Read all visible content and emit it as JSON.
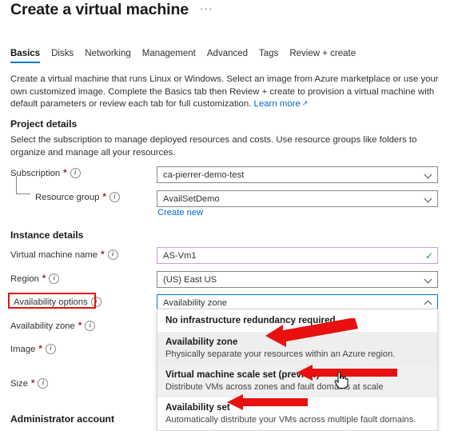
{
  "header": {
    "title": "Create a virtual machine",
    "more_menu": "···"
  },
  "tabs": [
    {
      "label": "Basics",
      "selected": true
    },
    {
      "label": "Disks",
      "selected": false
    },
    {
      "label": "Networking",
      "selected": false
    },
    {
      "label": "Management",
      "selected": false
    },
    {
      "label": "Advanced",
      "selected": false
    },
    {
      "label": "Tags",
      "selected": false
    },
    {
      "label": "Review + create",
      "selected": false
    }
  ],
  "intro": {
    "text": "Create a virtual machine that runs Linux or Windows. Select an image from Azure marketplace or use your own customized image. Complete the Basics tab then Review + create to provision a virtual machine with default parameters or review each tab for full customization. ",
    "link": "Learn more",
    "link_icon": "external-link-icon"
  },
  "project_details": {
    "heading": "Project details",
    "description": "Select the subscription to manage deployed resources and costs. Use resource groups like folders to organize and manage all your resources.",
    "subscription": {
      "label": "Subscription",
      "required": "*",
      "info": "i",
      "value": "ca-pierrer-demo-test"
    },
    "resource_group": {
      "label": "Resource group",
      "required": "*",
      "info": "i",
      "value": "AvailSetDemo",
      "create_new": "Create new"
    }
  },
  "instance_details": {
    "heading": "Instance details",
    "vm_name": {
      "label": "Virtual machine name",
      "required": "*",
      "info": "i",
      "value": "AS-Vm1",
      "valid_icon": "✓",
      "valid_color": "#2a9a3d",
      "border_color": "#c9a0dc"
    },
    "region": {
      "label": "Region",
      "required": "*",
      "info": "i",
      "value": "(US) East US"
    },
    "availability_options": {
      "label": "Availability options",
      "info": "i",
      "value": "Availability zone",
      "expanded": true,
      "chevron": "chevron-up-icon",
      "options": [
        {
          "title": "No infrastructure redundancy required",
          "subtitle": "",
          "highlighted": false
        },
        {
          "title": "Availability zone",
          "subtitle": "Physically separate your resources within an Azure region.",
          "highlighted": true
        },
        {
          "title": "Virtual machine scale set (preview)",
          "subtitle": "Distribute VMs across zones and fault domains at scale",
          "highlighted": true
        },
        {
          "title": "Availability set",
          "subtitle": "Automatically distribute your VMs across multiple fault domains.",
          "highlighted": false
        }
      ]
    },
    "availability_zone": {
      "label": "Availability zone",
      "required": "*",
      "info": "i"
    },
    "image": {
      "label": "Image",
      "required": "*",
      "info": "i"
    },
    "size": {
      "label": "Size",
      "required": "*",
      "info": "i"
    }
  },
  "administrator_account": {
    "heading": "Administrator account"
  },
  "annotations": {
    "highlight_color": "#e8110f",
    "box_target": "availability-options-label",
    "arrow_targets": [
      "Availability zone",
      "Virtual machine scale set (preview)",
      "Availability set"
    ]
  }
}
